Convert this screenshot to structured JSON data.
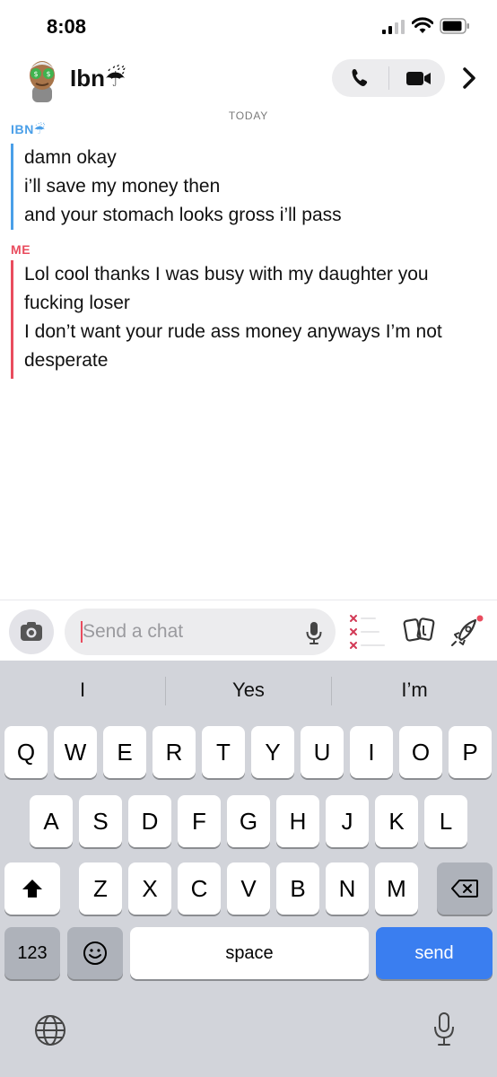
{
  "status_bar": {
    "time": "8:08"
  },
  "header": {
    "contact_name": "Ibn☔"
  },
  "chat": {
    "date_label": "TODAY",
    "groups": [
      {
        "sender": "IBN☔",
        "color": "#4a9fe8",
        "messages": [
          "damn okay",
          "i’ll save my money then",
          "and your stomach looks gross i’ll pass"
        ]
      },
      {
        "sender": "ME",
        "color": "#e94c5e",
        "messages": [
          "Lol cool thanks I was busy with my daughter you fucking loser",
          "I don’t want your rude ass money anyways I’m not desperate"
        ]
      }
    ]
  },
  "input_bar": {
    "placeholder": "Send a chat"
  },
  "keyboard": {
    "suggestions": [
      "I",
      "Yes",
      "I’m"
    ],
    "row1": [
      "Q",
      "W",
      "E",
      "R",
      "T",
      "Y",
      "U",
      "I",
      "O",
      "P"
    ],
    "row2": [
      "A",
      "S",
      "D",
      "F",
      "G",
      "H",
      "J",
      "K",
      "L"
    ],
    "row3": [
      "Z",
      "X",
      "C",
      "V",
      "B",
      "N",
      "M"
    ],
    "numbers_label": "123",
    "space_label": "space",
    "send_label": "send"
  },
  "icons": {
    "status": [
      "signal-icon",
      "wifi-icon",
      "battery-icon"
    ],
    "header": [
      "avatar",
      "phone-icon",
      "video-icon",
      "chevron-right-icon"
    ],
    "input": [
      "camera-icon",
      "mic-icon",
      "xxx-icon",
      "cards-icon",
      "rocket-icon"
    ],
    "keyboard": [
      "shift-icon",
      "backspace-icon",
      "emoji-icon",
      "globe-icon",
      "dictation-icon"
    ]
  },
  "colors": {
    "ibn": "#4a9fe8",
    "me": "#e94c5e",
    "send_key": "#3a7ef0"
  }
}
